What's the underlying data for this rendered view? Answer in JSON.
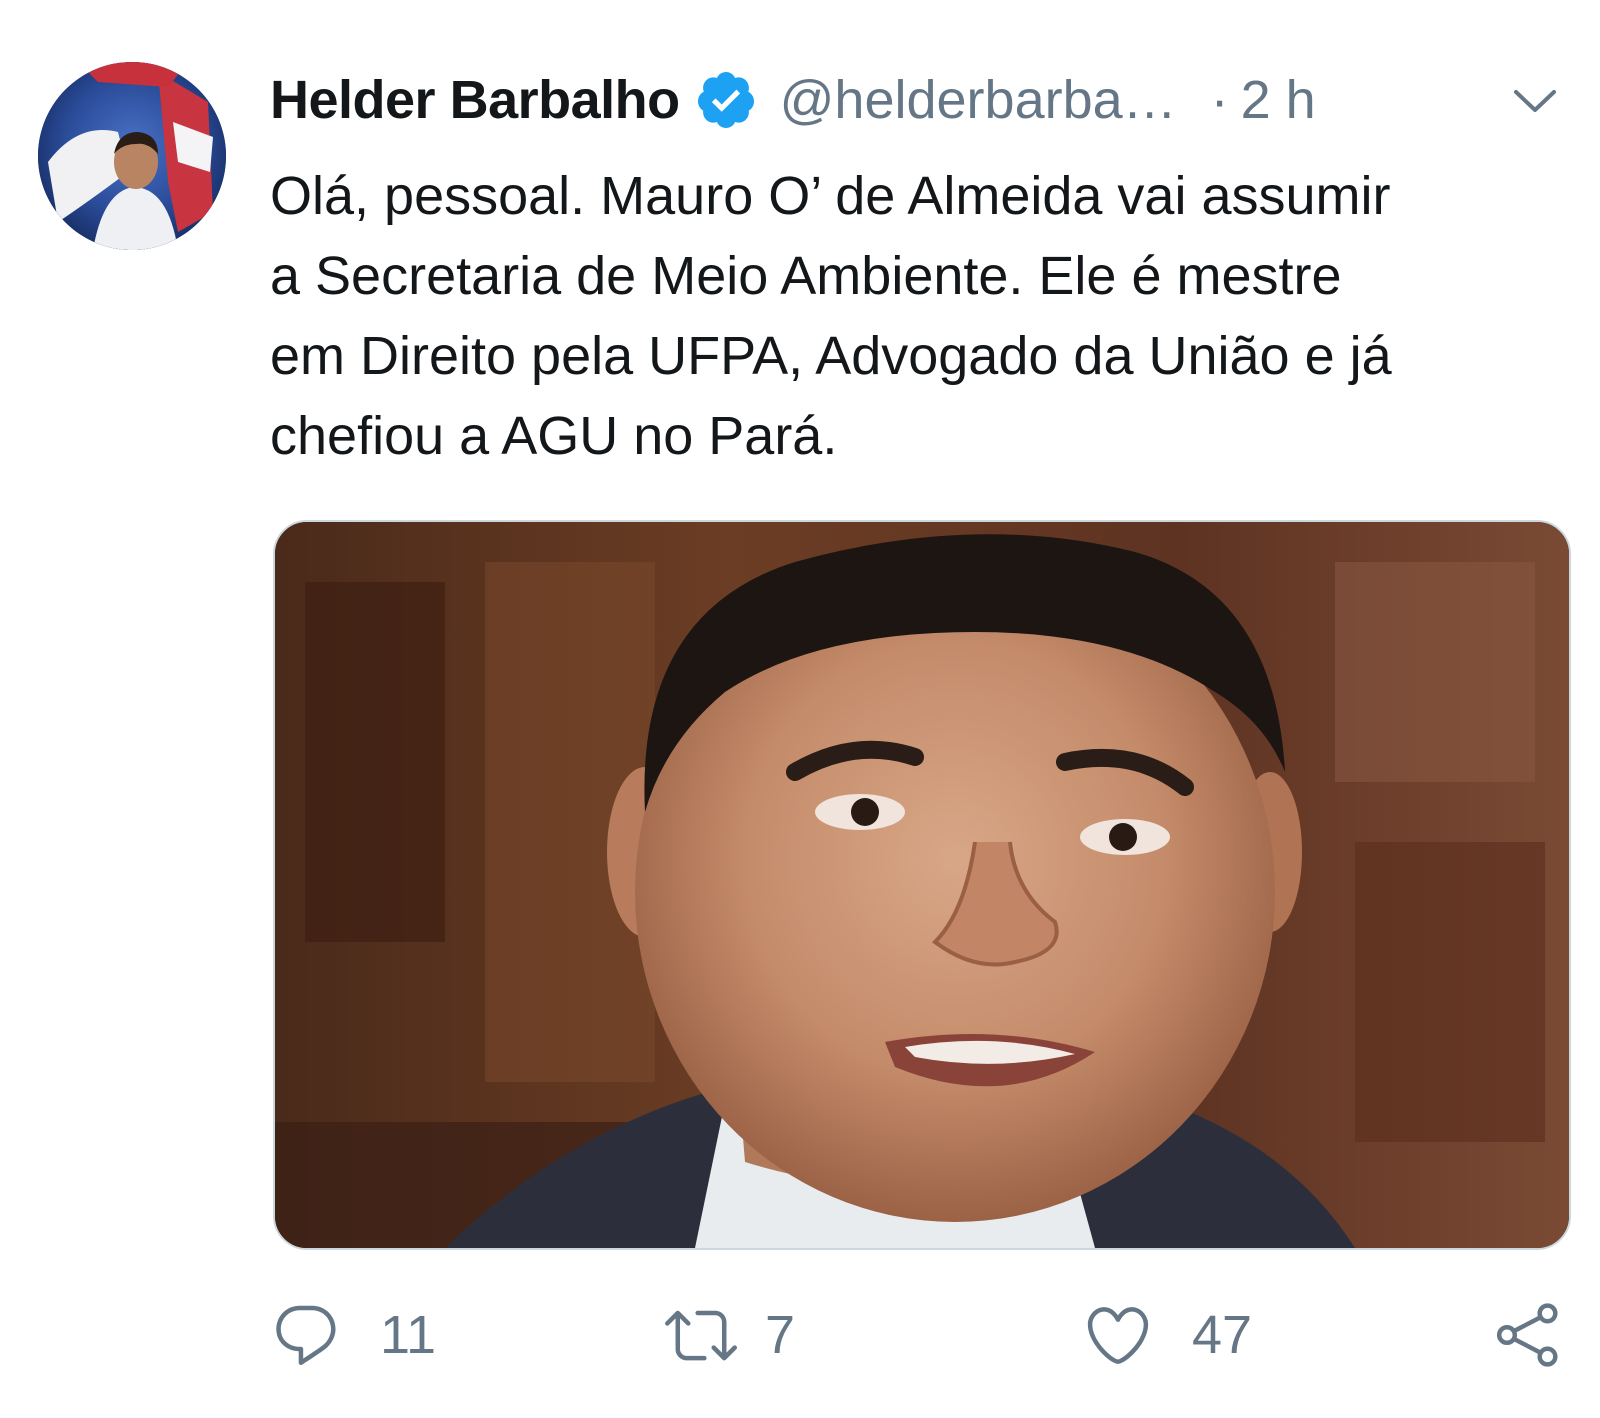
{
  "tweet": {
    "author": {
      "display_name": "Helder Barbalho",
      "handle": "@helderbarba…",
      "verified": true,
      "avatar_icon": "avatar-photo"
    },
    "separator": "·",
    "time": "2 h",
    "text": "Olá, pessoal. Mauro O’ de Almeida vai assumir\na Secretaria de Meio Ambiente. Ele é mestre\nem Direito pela UFPA, Advogado da União e já\nchefiou a AGU no Pará.",
    "media_icon": "tweet-photo",
    "actions": {
      "reply": {
        "icon": "reply-icon",
        "count": "11"
      },
      "retweet": {
        "icon": "retweet-icon",
        "count": "7"
      },
      "like": {
        "icon": "heart-icon",
        "count": "47"
      },
      "share": {
        "icon": "share-icon"
      }
    }
  },
  "colors": {
    "text": "#14171a",
    "secondary": "#657786",
    "verified_blue": "#1da1f2",
    "media_border": "#ccd6dd"
  }
}
